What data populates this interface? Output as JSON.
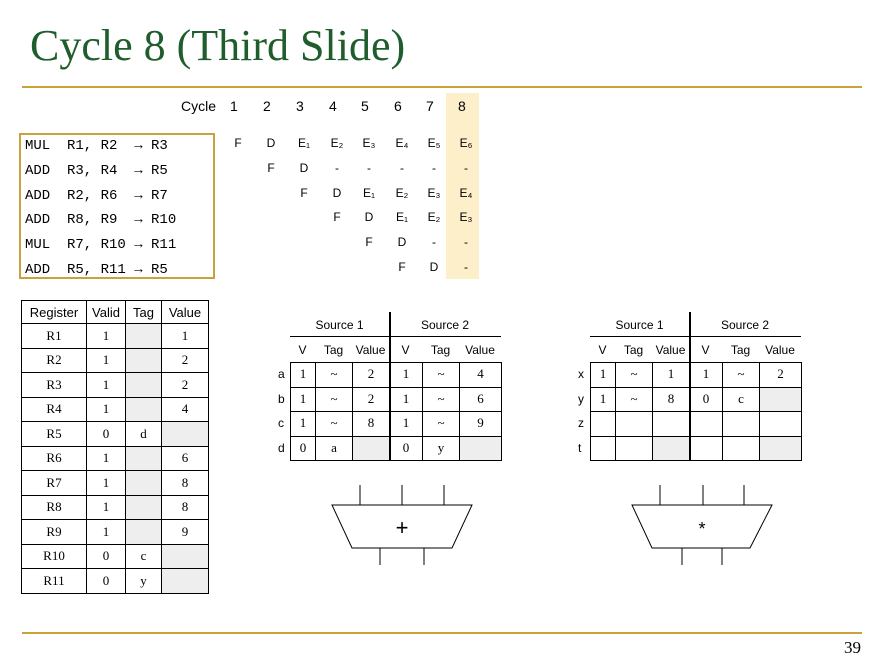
{
  "title": "Cycle 8 (Third Slide)",
  "page_number": "39",
  "pipeline": {
    "cycle_label": "Cycle",
    "cycles": [
      "1",
      "2",
      "3",
      "4",
      "5",
      "6",
      "7",
      "8"
    ],
    "instructions": [
      {
        "text": "MUL  R1, R2  → R3",
        "stages": [
          "F",
          "D",
          "E₁",
          "E₂",
          "E₃",
          "E₄",
          "E₅",
          "E₆"
        ],
        "start": 0
      },
      {
        "text": "ADD  R3, R4  → R5",
        "stages": [
          "F",
          "D",
          "-",
          "-",
          "-",
          "-",
          "-"
        ],
        "start": 1
      },
      {
        "text": "ADD  R2, R6  → R7",
        "stages": [
          "F",
          "D",
          "E₁",
          "E₂",
          "E₃",
          "E₄"
        ],
        "start": 2
      },
      {
        "text": "ADD  R8, R9  → R10",
        "stages": [
          "F",
          "D",
          "E₁",
          "E₂",
          "E₃"
        ],
        "start": 3
      },
      {
        "text": "MUL  R7, R10 → R11",
        "stages": [
          "F",
          "D",
          "-",
          "-"
        ],
        "start": 4
      },
      {
        "text": "ADD  R5, R11 → R5",
        "stages": [
          "F",
          "D",
          "-"
        ],
        "start": 5
      }
    ]
  },
  "register_file": {
    "headers": [
      "Register",
      "Valid",
      "Tag",
      "Value"
    ],
    "rows": [
      [
        "R1",
        "1",
        "",
        "1"
      ],
      [
        "R2",
        "1",
        "",
        "2"
      ],
      [
        "R3",
        "1",
        "",
        "2"
      ],
      [
        "R4",
        "1",
        "",
        "4"
      ],
      [
        "R5",
        "0",
        "d",
        ""
      ],
      [
        "R6",
        "1",
        "",
        "6"
      ],
      [
        "R7",
        "1",
        "",
        "8"
      ],
      [
        "R8",
        "1",
        "",
        "8"
      ],
      [
        "R9",
        "1",
        "",
        "9"
      ],
      [
        "R10",
        "0",
        "c",
        ""
      ],
      [
        "R11",
        "0",
        "y",
        ""
      ]
    ]
  },
  "adder_rs": {
    "source1_label": "Source 1",
    "source2_label": "Source 2",
    "col_headers": [
      "V",
      "Tag",
      "Value",
      "V",
      "Tag",
      "Value"
    ],
    "rows": [
      {
        "label": "a",
        "cells": [
          "1",
          "~",
          "2",
          "1",
          "~",
          "4"
        ]
      },
      {
        "label": "b",
        "cells": [
          "1",
          "~",
          "2",
          "1",
          "~",
          "6"
        ]
      },
      {
        "label": "c",
        "cells": [
          "1",
          "~",
          "8",
          "1",
          "~",
          "9"
        ]
      },
      {
        "label": "d",
        "cells": [
          "0",
          "a",
          "",
          "0",
          "y",
          ""
        ]
      }
    ],
    "unit_symbol": "+"
  },
  "mult_rs": {
    "source1_label": "Source 1",
    "source2_label": "Source 2",
    "col_headers": [
      "V",
      "Tag",
      "Value",
      "V",
      "Tag",
      "Value"
    ],
    "rows": [
      {
        "label": "x",
        "cells": [
          "1",
          "~",
          "1",
          "1",
          "~",
          "2"
        ]
      },
      {
        "label": "y",
        "cells": [
          "1",
          "~",
          "8",
          "0",
          "c",
          ""
        ]
      },
      {
        "label": "z",
        "cells": [
          "",
          "",
          "",
          "",
          "",
          ""
        ]
      },
      {
        "label": "t",
        "cells": [
          "",
          "",
          "",
          "",
          "",
          ""
        ]
      }
    ],
    "unit_symbol": "*"
  },
  "colors": {
    "title": "#1f5d2c",
    "rule": "#c9a23a",
    "highlight": "#fcefc9",
    "shade": "#eeeeee"
  }
}
